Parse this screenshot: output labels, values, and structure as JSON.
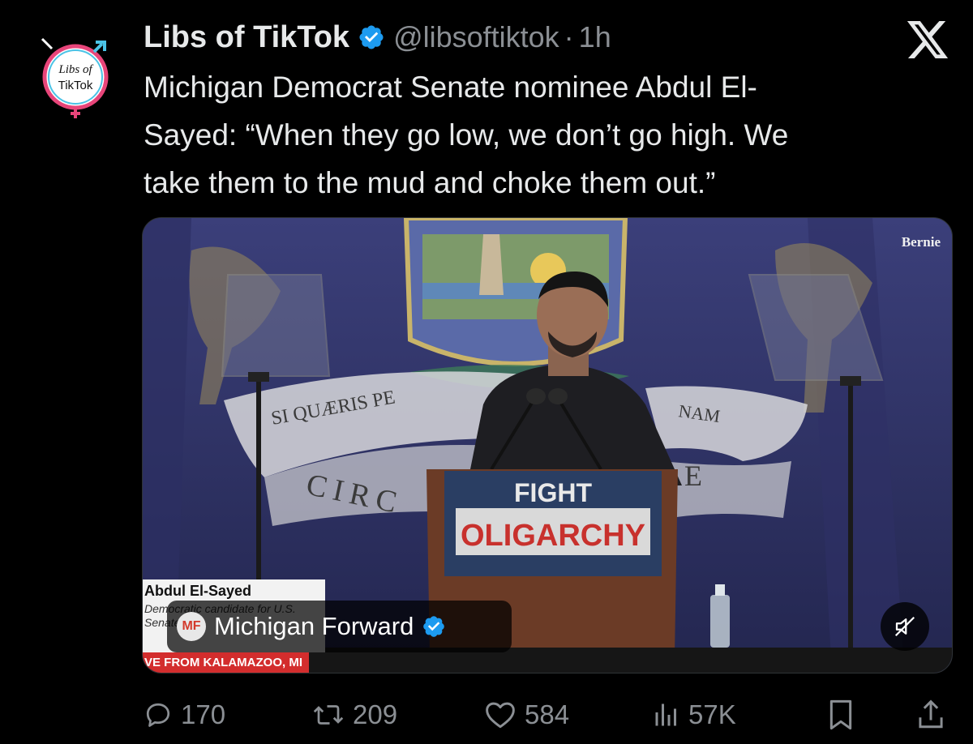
{
  "tweet": {
    "author_name": "Libs of TikTok",
    "handle": "@libsoftiktok",
    "separator": "·",
    "time": "1h",
    "text_lines": [
      "Michigan Democrat Senate nominee Abdul El-",
      "Sayed: “When they go low, we don’t go high. We",
      "take them to the mud and choke them out.”"
    ],
    "avatar_text_1": "Libs of",
    "avatar_text_2": "TikTok"
  },
  "media": {
    "watermark": "Bernie",
    "lower_third": {
      "name": "Abdul El-Sayed",
      "role": "Democratic candidate for U.S. Senate",
      "location": "VE FROM KALAMAZOO, MI"
    },
    "podium_line1": "FIGHT",
    "podium_line2": "OLIGARCHY",
    "banner_text_1": "SI QUÆRIS PE",
    "banner_text_2": "NAM",
    "banner_text_3": "CIRC",
    "banner_text_4": "E",
    "attribution": {
      "logo": "MF",
      "name": "Michigan Forward"
    }
  },
  "actions": {
    "replies": "170",
    "reposts": "209",
    "likes": "584",
    "views": "57K"
  },
  "colors": {
    "verified": "#1d9bf0",
    "background": "#000000",
    "muted_text": "#8b8f94"
  },
  "icons": [
    "x-logo-icon",
    "verified-icon",
    "reply-icon",
    "repost-icon",
    "like-icon",
    "views-icon",
    "bookmark-icon",
    "share-icon",
    "mute-icon"
  ]
}
